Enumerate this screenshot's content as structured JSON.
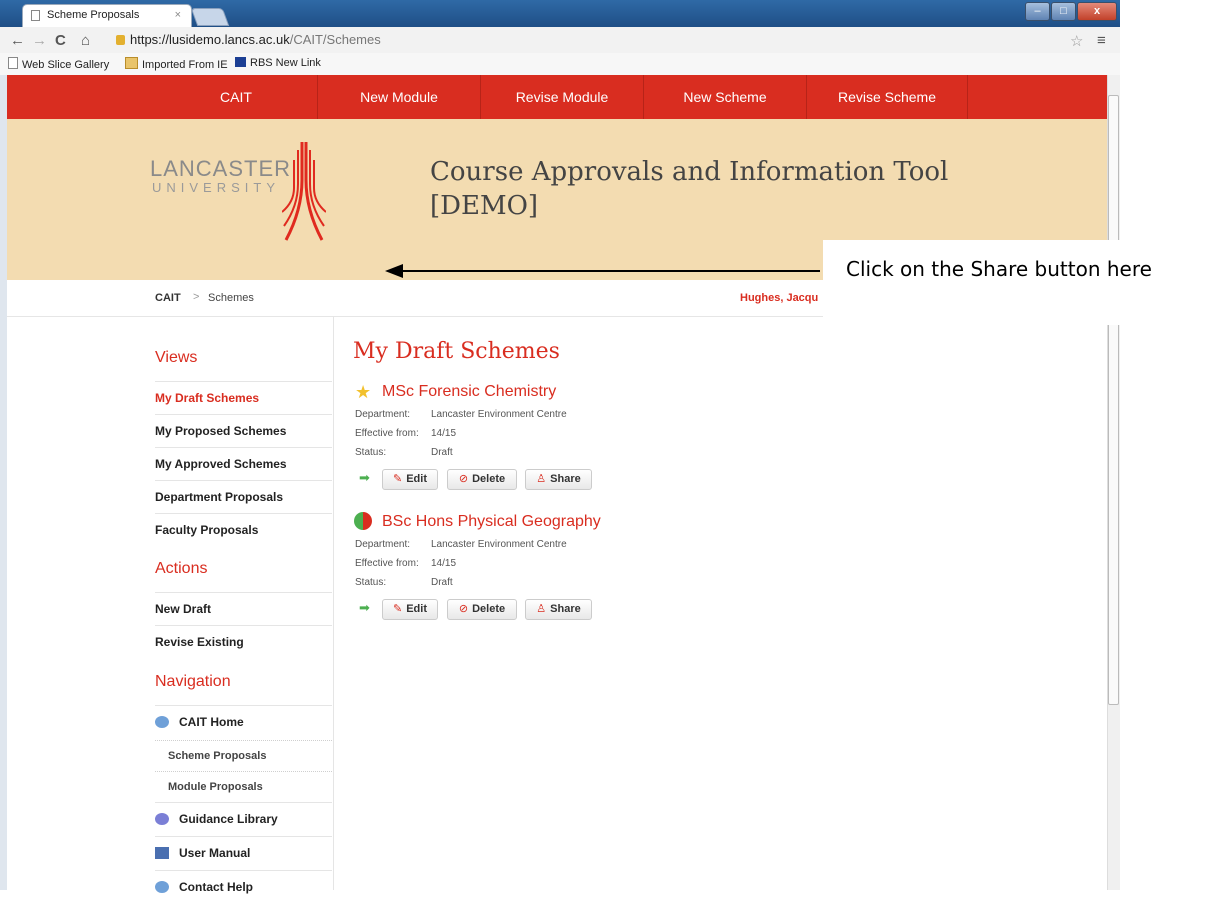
{
  "browser": {
    "tab_title": "Scheme Proposals",
    "tab_close": "×",
    "url_host": "https://lusidemo.lancs.ac.uk",
    "url_path": "/CAIT/Schemes",
    "window_min": "–",
    "window_max": "□",
    "window_close": "x",
    "bookmarks": [
      "Web Slice Gallery",
      "Imported From IE",
      "RBS New Link"
    ]
  },
  "site_nav": [
    "CAIT",
    "New Module",
    "Revise Module",
    "New Scheme",
    "Revise Scheme"
  ],
  "banner": {
    "logo_top": "LANCASTER",
    "logo_bottom": "UNIVERSITY",
    "title": "Course Approvals and Information Tool [DEMO]"
  },
  "breadcrumb": {
    "root": "CAIT",
    "separator": ">",
    "current": "Schemes"
  },
  "user_name": "Hughes, Jacqu",
  "sidebar": {
    "views_heading": "Views",
    "views": [
      "My Draft Schemes",
      "My Proposed Schemes",
      "My Approved Schemes",
      "Department Proposals",
      "Faculty Proposals"
    ],
    "actions_heading": "Actions",
    "actions": [
      "New Draft",
      "Revise Existing"
    ],
    "navigation_heading": "Navigation",
    "navigation": [
      "CAIT Home",
      "Scheme Proposals",
      "Module Proposals",
      "Guidance Library",
      "User Manual",
      "Contact Help"
    ]
  },
  "main": {
    "title": "My Draft Schemes",
    "labels": {
      "department": "Department:",
      "effective": "Effective from:",
      "status": "Status:"
    },
    "buttons": {
      "edit": "Edit",
      "delete": "Delete",
      "share": "Share"
    },
    "schemes": [
      {
        "title": "MSc Forensic Chemistry",
        "department": "Lancaster Environment Centre",
        "effective": "14/15",
        "status": "Draft",
        "icon": "star-icon"
      },
      {
        "title": "BSc Hons Physical Geography",
        "department": "Lancaster Environment Centre",
        "effective": "14/15",
        "status": "Draft",
        "icon": "revise-icon"
      }
    ]
  },
  "annotation": "Click on the Share button here",
  "colors": {
    "brand_red": "#d92d20",
    "banner": "#f3dcb1"
  }
}
